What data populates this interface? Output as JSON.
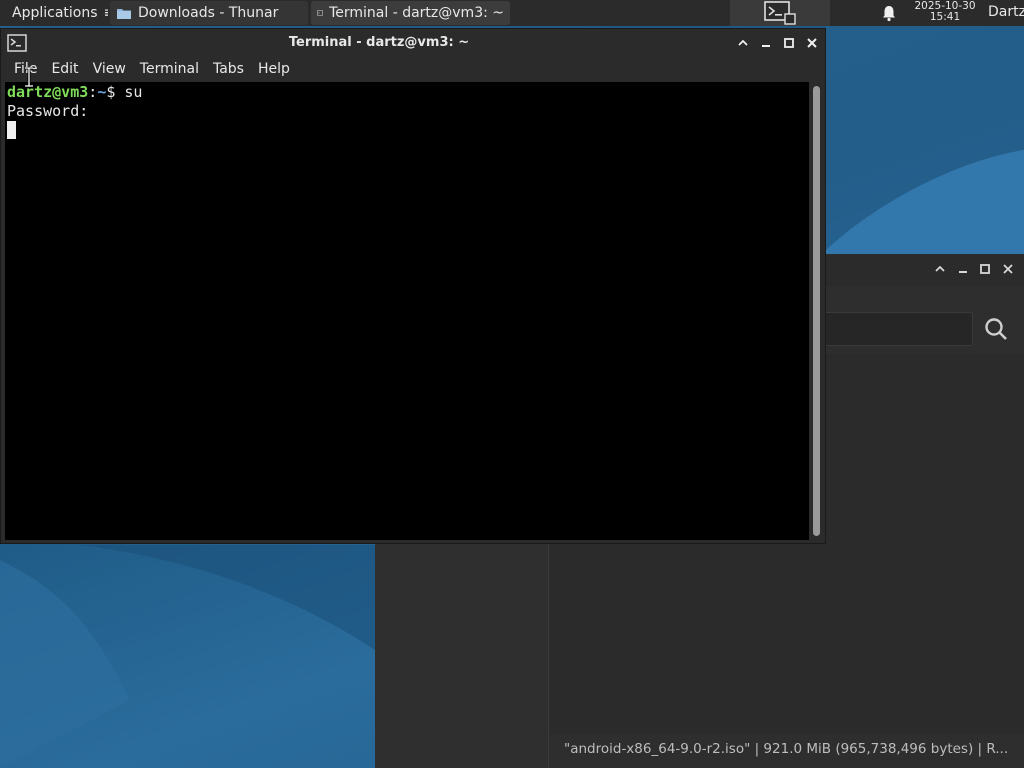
{
  "panel": {
    "applications_label": "Applications",
    "tasks": [
      {
        "label": "Downloads - Thunar",
        "icon": "folder-icon"
      },
      {
        "label": "Terminal - dartz@vm3: ~",
        "icon": "terminal-icon"
      }
    ],
    "clock_date": "2025-10-30",
    "clock_time": "15:41",
    "user": "Dartz"
  },
  "terminal": {
    "title": "Terminal - dartz@vm3: ~",
    "menu": [
      "File",
      "Edit",
      "View",
      "Terminal",
      "Tabs",
      "Help"
    ],
    "prompt_user": "dartz@vm3",
    "prompt_sep": ":",
    "prompt_path": "~",
    "prompt_symbol": "$ ",
    "command": "su",
    "output_line": "Password:"
  },
  "thunar": {
    "status": "\"android-x86_64-9.0-r2.iso\"  |  921.0 MiB (965,738,496 bytes)  |  R..."
  },
  "colors": {
    "prompt_user": "#7edc5a",
    "prompt_path": "#6aa7e0",
    "panel_bg": "#2b2b2b",
    "terminal_bg": "#000000"
  }
}
